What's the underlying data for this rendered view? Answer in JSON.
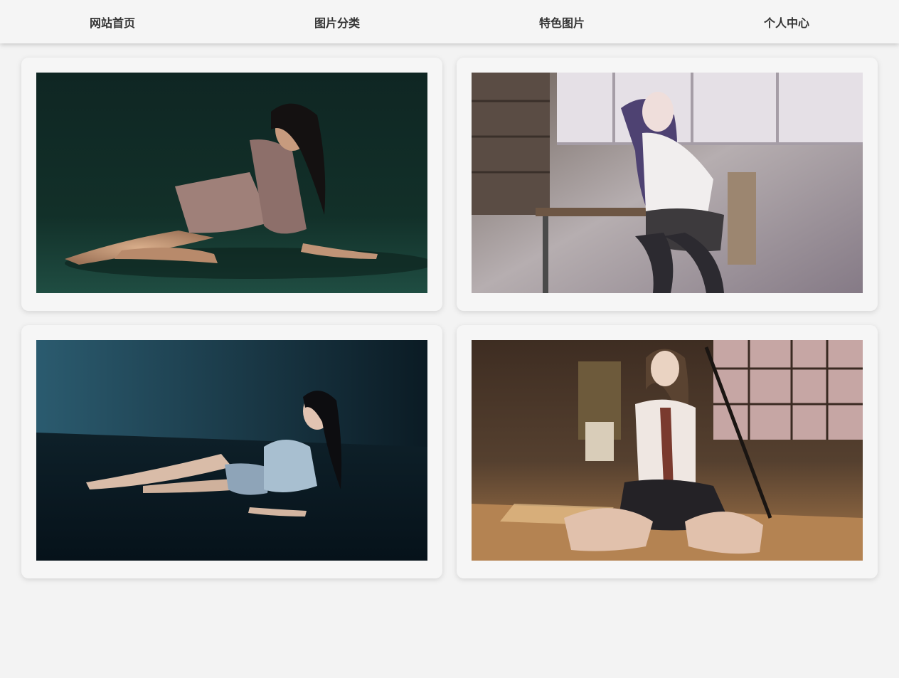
{
  "nav": {
    "items": [
      {
        "label": "网站首页"
      },
      {
        "label": "图片分类"
      },
      {
        "label": "特色图片"
      },
      {
        "label": "个人中心"
      }
    ]
  },
  "gallery": {
    "photos": [
      {
        "subject": "woman in sequined outfit reclining on dark green studio floor",
        "palette": [
          "#123029",
          "#1d4a3f",
          "#c9a07e"
        ]
      },
      {
        "subject": "anime-style girl with purple hair seated at classroom desk",
        "palette": [
          "#d8d2d6",
          "#7a6a62",
          "#4b3f5c"
        ]
      },
      {
        "subject": "woman in floral top lying on dark teal studio floor",
        "palette": [
          "#1a3a48",
          "#0c1b24",
          "#d9c2b0"
        ]
      },
      {
        "subject": "anime-style girl in school uniform sitting on tatami floor with sword",
        "palette": [
          "#3a2a1e",
          "#c89a62",
          "#e8c9c6"
        ]
      }
    ]
  }
}
